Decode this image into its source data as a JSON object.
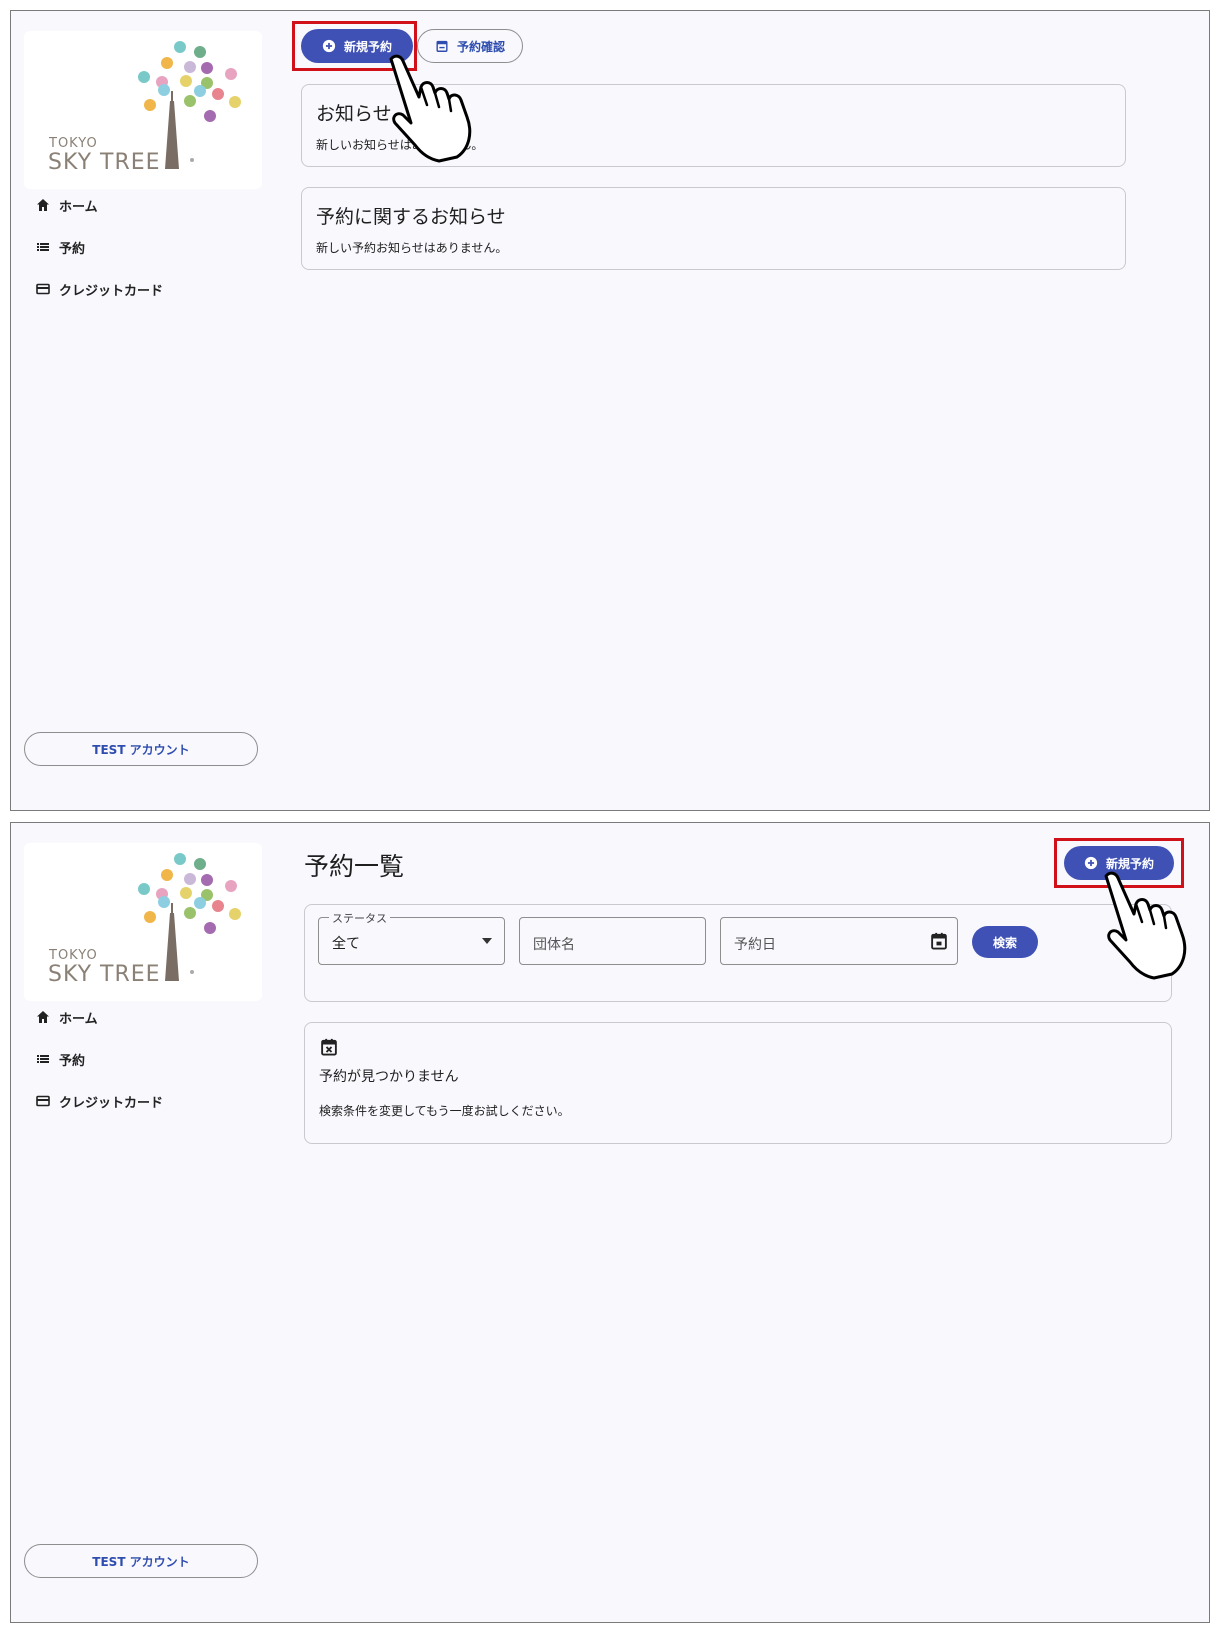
{
  "brand": {
    "logo_line1": "TOKYO",
    "logo_line2": "SKY TREE",
    "dot_colors": [
      "#7ac9c9",
      "#6fae8a",
      "#e8a3c0",
      "#f0b64a",
      "#c9b8d8",
      "#a56bb0",
      "#e6d26a",
      "#9ac26a",
      "#e8848e",
      "#8dcfe0"
    ]
  },
  "sidebar": {
    "items": [
      {
        "label": "ホーム",
        "icon": "home-icon"
      },
      {
        "label": "予約",
        "icon": "list-icon"
      },
      {
        "label": "クレジットカード",
        "icon": "credit-card-icon"
      }
    ],
    "account_label": "TEST アカウント"
  },
  "screen1": {
    "toolbar": {
      "new_reservation": "新規予約",
      "confirm_reservation": "予約確認"
    },
    "cards": [
      {
        "title": "お知らせ",
        "body": "新しいお知らせはありません。"
      },
      {
        "title": "予約に関するお知らせ",
        "body": "新しい予約お知らせはありません。"
      }
    ]
  },
  "screen2": {
    "title": "予約一覧",
    "new_reservation": "新規予約",
    "filters": {
      "status_label": "ステータス",
      "status_value": "全て",
      "group_placeholder": "団体名",
      "date_placeholder": "予約日",
      "search_button": "検索"
    },
    "empty": {
      "title": "予約が見つかりません",
      "message": "検索条件を変更してもう一度お試しください。"
    }
  },
  "colors": {
    "primary": "#3f51b5",
    "highlight": "#d0111a",
    "background": "#f8f8fd"
  }
}
